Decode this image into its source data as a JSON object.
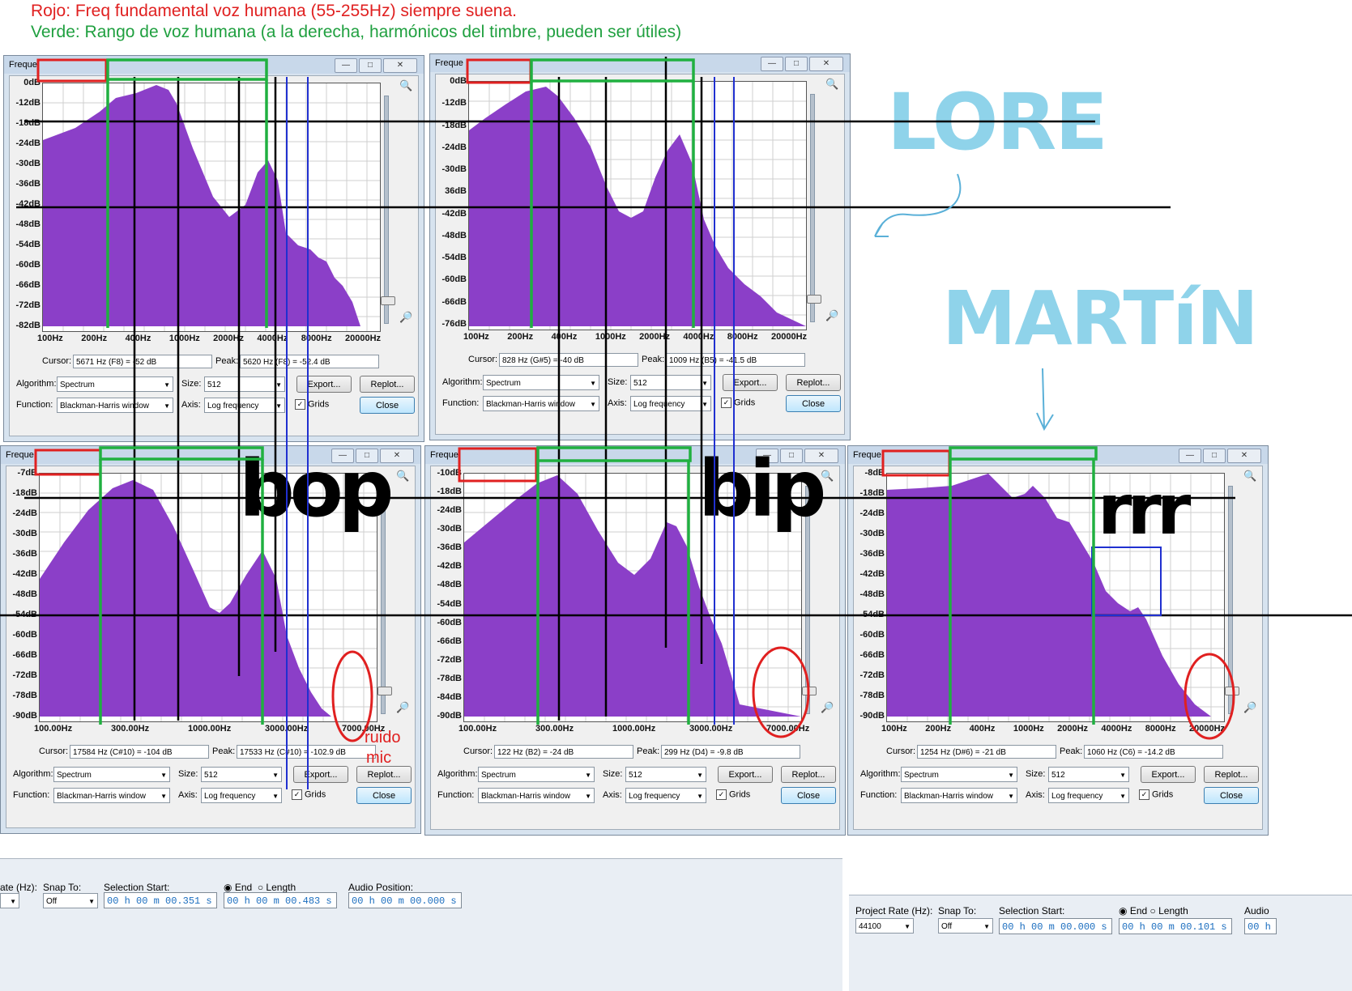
{
  "notes": {
    "red": "Rojo: Freq fundamental voz humana (55-255Hz) siempre suena.",
    "green": "Verde: Rango de voz humana (a la derecha, harmónicos del timbre, pueden ser útiles)"
  },
  "labels": {
    "lore": "LORE",
    "martin": "MARTíN",
    "bop": "bop",
    "bip": "bip",
    "rrr": "rrr",
    "ruido": "ruido",
    "mic": "mic"
  },
  "colors": {
    "spectrum": "#8b3fc8",
    "red_marker": "#e02020",
    "green_marker": "#20b040",
    "blue_line": "#2030d0",
    "name_label": "#8fd3ea"
  },
  "common": {
    "title": "Freque",
    "cursor_label": "Cursor:",
    "peak_label": "Peak:",
    "algorithm_label": "Algorithm:",
    "function_label": "Function:",
    "size_label": "Size:",
    "axis_label": "Axis:",
    "algorithm": "Spectrum",
    "function": "Blackman-Harris window",
    "size": "512",
    "axis": "Log frequency",
    "export": "Export...",
    "replot": "Replot...",
    "grids": "Grids",
    "close": "Close"
  },
  "windows": [
    {
      "id": "w1",
      "cursor": "5671 Hz (F8) = -52 dB",
      "peak": "5620 Hz (F8) = -52.4 dB",
      "y_ticks": [
        "0dB",
        "-12dB",
        "-18dB",
        "-24dB",
        "-30dB",
        "-36dB",
        "-42dB",
        "-48dB",
        "-54dB",
        "-60dB",
        "-66dB",
        "-72dB",
        "-82dB"
      ],
      "x_ticks": [
        "100Hz",
        "200Hz",
        "400Hz",
        "1000Hz",
        "2000Hz",
        "4000Hz",
        "8000Hz",
        "20000Hz"
      ]
    },
    {
      "id": "w2",
      "cursor": "828 Hz (G#5) = -40 dB",
      "peak": "1009 Hz (B5) = -41.5 dB",
      "y_ticks": [
        "0dB",
        "-12dB",
        "-18dB",
        "-24dB",
        "-30dB",
        "36dB",
        "-42dB",
        "-48dB",
        "-54dB",
        "-60dB",
        "-66dB",
        "-76dB"
      ],
      "x_ticks": [
        "100Hz",
        "200Hz",
        "400Hz",
        "1000Hz",
        "2000Hz",
        "4000Hz",
        "8000Hz",
        "20000Hz"
      ]
    },
    {
      "id": "w3",
      "cursor": "17584 Hz (C#10) = -104 dB",
      "peak": "17533 Hz (C#10) = -102.9 dB",
      "y_ticks": [
        "-7dB",
        "-18dB",
        "-24dB",
        "-30dB",
        "-36dB",
        "-42dB",
        "-48dB",
        "-54dB",
        "-60dB",
        "-66dB",
        "-72dB",
        "-78dB",
        "-90dB"
      ],
      "x_ticks": [
        "100.00Hz",
        "300.00Hz",
        "1000.00Hz",
        "3000.00Hz",
        "7000.00Hz"
      ]
    },
    {
      "id": "w4",
      "cursor": "122 Hz (B2) = -24 dB",
      "peak": "299 Hz (D4) = -9.8 dB",
      "y_ticks": [
        "-10dB",
        "-18dB",
        "-24dB",
        "-30dB",
        "-36dB",
        "-42dB",
        "-48dB",
        "-54dB",
        "-60dB",
        "-66dB",
        "-72dB",
        "-78dB",
        "-84dB",
        "-90dB"
      ],
      "x_ticks": [
        "100.00Hz",
        "300.00Hz",
        "1000.00Hz",
        "3000.00Hz",
        "7000.00Hz"
      ]
    },
    {
      "id": "w5",
      "cursor": "1254 Hz (D#6) = -21 dB",
      "peak": "1060 Hz (C6) = -14.2 dB",
      "y_ticks": [
        "-8dB",
        "-18dB",
        "-24dB",
        "-30dB",
        "-36dB",
        "-42dB",
        "-48dB",
        "-54dB",
        "-60dB",
        "-66dB",
        "-72dB",
        "-78dB",
        "-90dB"
      ],
      "x_ticks": [
        "100Hz",
        "200Hz",
        "400Hz",
        "1000Hz",
        "2000Hz",
        "4000Hz",
        "8000Hz",
        "20000Hz"
      ]
    }
  ],
  "selection_bar_left": {
    "rate_label": "ate (Hz):",
    "snap_label": "Snap To:",
    "snap_value": "Off",
    "sel_start_label": "Selection Start:",
    "end_label": "End",
    "length_label": "Length",
    "audio_pos_label": "Audio Position:",
    "start_time": "00 h 00 m 00.351 s",
    "end_time": "00 h 00 m 00.483 s",
    "audio_time": "00 h 00 m 00.000 s"
  },
  "selection_bar_right": {
    "rate_label": "Project Rate (Hz):",
    "rate_value": "44100",
    "snap_label": "Snap To:",
    "snap_value": "Off",
    "sel_start_label": "Selection Start:",
    "end_label": "End",
    "length_label": "Length",
    "audio_label": "Audio",
    "start_time": "00 h 00 m 00.000 s",
    "end_time": "00 h 00 m 00.101 s",
    "audio_time": "00 h"
  }
}
